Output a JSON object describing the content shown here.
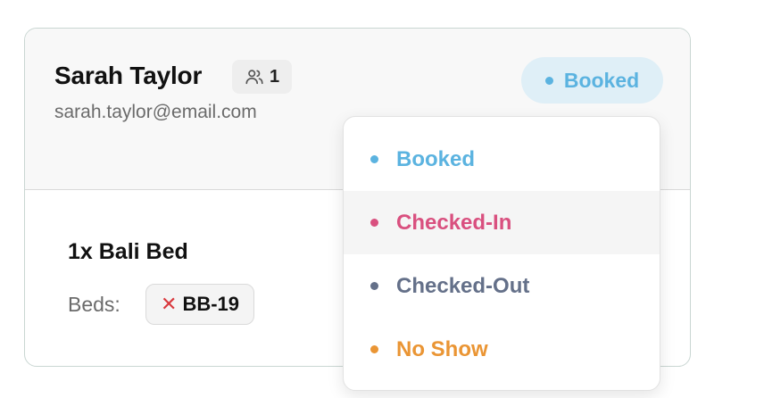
{
  "guest": {
    "name": "Sarah Taylor",
    "count": "1",
    "email": "sarah.taylor@email.com"
  },
  "status": {
    "current": "Booked",
    "current_color": "#5bb3e0"
  },
  "booking_item": {
    "title": "1x Bali Bed",
    "beds_label": "Beds:",
    "bed_code": "BB-19",
    "remove_glyph": "✕"
  },
  "status_options": [
    {
      "label": "Booked",
      "color": "#5bb3e0"
    },
    {
      "label": "Checked-In",
      "color": "#d9507f"
    },
    {
      "label": "Checked-Out",
      "color": "#647089"
    },
    {
      "label": "No Show",
      "color": "#ea9534"
    }
  ],
  "icons": {
    "guests": "users-icon",
    "remove": "close-icon"
  }
}
